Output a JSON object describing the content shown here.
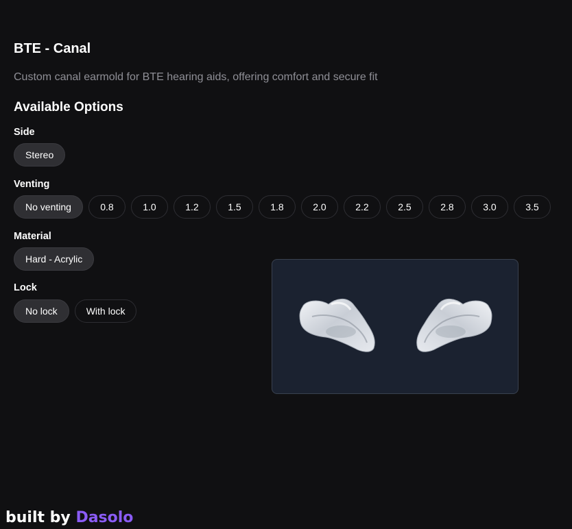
{
  "product": {
    "title": "BTE - Canal",
    "description": "Custom canal earmold for BTE hearing aids, offering comfort and secure fit"
  },
  "options": {
    "heading": "Available Options",
    "side": {
      "label": "Side",
      "choices": [
        "Stereo"
      ],
      "selected": "Stereo"
    },
    "venting": {
      "label": "Venting",
      "choices": [
        "No venting",
        "0.8",
        "1.0",
        "1.2",
        "1.5",
        "1.8",
        "2.0",
        "2.2",
        "2.5",
        "2.8",
        "3.0",
        "3.5"
      ],
      "selected": "No venting"
    },
    "material": {
      "label": "Material",
      "choices": [
        "Hard - Acrylic"
      ],
      "selected": "Hard - Acrylic"
    },
    "lock": {
      "label": "Lock",
      "choices": [
        "No lock",
        "With lock"
      ],
      "selected": "No lock"
    }
  },
  "footer": {
    "prefix": "built by",
    "brand": "Dasolo"
  },
  "colors": {
    "background": "#101012",
    "brand": "#8b5cf6",
    "preview_bg": "#1b2230",
    "chip_selected": "#2f2f33"
  }
}
